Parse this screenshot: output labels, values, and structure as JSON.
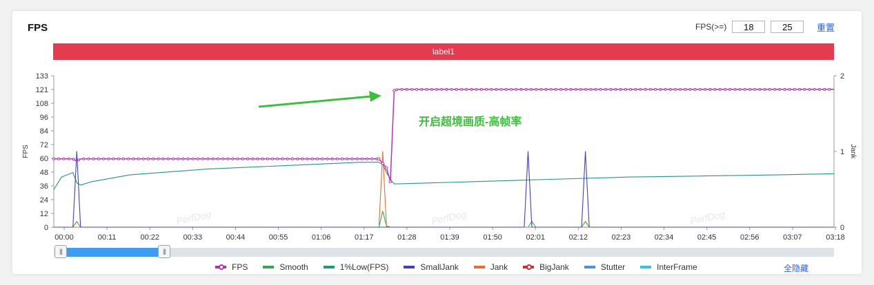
{
  "panel": {
    "title": "FPS"
  },
  "fps_threshold": {
    "label": "FPS(>=)",
    "low": "18",
    "high": "25",
    "reset_label": "重置"
  },
  "label_bar": {
    "text": "label1"
  },
  "annotation": {
    "text": "开启超境画质-高帧率"
  },
  "watermark": "PerfDog",
  "legend": {
    "items": [
      {
        "name": "FPS",
        "color": "#b832b0",
        "marker": true
      },
      {
        "name": "Smooth",
        "color": "#33a852",
        "marker": false
      },
      {
        "name": "1%Low(FPS)",
        "color": "#1f9688",
        "marker": false
      },
      {
        "name": "SmallJank",
        "color": "#3f3fc8",
        "marker": false
      },
      {
        "name": "Jank",
        "color": "#ef6a2e",
        "marker": false
      },
      {
        "name": "BigJank",
        "color": "#d82b2b",
        "marker": true
      },
      {
        "name": "Stutter",
        "color": "#4a8fe8",
        "marker": false
      },
      {
        "name": "InterFrame",
        "color": "#2ec8dc",
        "marker": false
      }
    ],
    "hide_all_label": "全隐藏"
  },
  "chart_data": {
    "type": "line",
    "ylabel": "FPS",
    "y2label": "Jank",
    "ylim": [
      0,
      133
    ],
    "y2lim": [
      0,
      2
    ],
    "xlim": [
      0,
      204
    ],
    "yticks": [
      "0",
      "12",
      "24",
      "36",
      "48",
      "60",
      "72",
      "84",
      "96",
      "108",
      "121",
      "133"
    ],
    "y2ticks": [
      "0",
      "1",
      "2"
    ],
    "xticks": [
      "00:00",
      "00:11",
      "00:22",
      "00:33",
      "00:44",
      "00:55",
      "01:06",
      "01:17",
      "01:28",
      "01:39",
      "01:50",
      "02:01",
      "02:12",
      "02:23",
      "02:34",
      "02:45",
      "02:56",
      "03:07",
      "03:18"
    ],
    "series": [
      {
        "name": "FPS",
        "axis": "left",
        "points": [
          [
            0,
            60
          ],
          [
            5,
            60
          ],
          [
            6,
            58
          ],
          [
            7,
            60
          ],
          [
            85,
            60
          ],
          [
            86,
            56
          ],
          [
            87,
            52
          ],
          [
            88,
            40
          ],
          [
            89,
            120
          ],
          [
            90,
            121
          ],
          [
            204,
            121
          ]
        ]
      },
      {
        "name": "1%Low(FPS)",
        "axis": "left",
        "points": [
          [
            0,
            33
          ],
          [
            2,
            44
          ],
          [
            5,
            48
          ],
          [
            6,
            39
          ],
          [
            7,
            37
          ],
          [
            10,
            40
          ],
          [
            20,
            46
          ],
          [
            40,
            51
          ],
          [
            60,
            54
          ],
          [
            80,
            57
          ],
          [
            85,
            57
          ],
          [
            86,
            55
          ],
          [
            87,
            48
          ],
          [
            88,
            42
          ],
          [
            89,
            38
          ],
          [
            90,
            38
          ],
          [
            110,
            40
          ],
          [
            130,
            42
          ],
          [
            150,
            44
          ],
          [
            170,
            45
          ],
          [
            190,
            46
          ],
          [
            204,
            47
          ]
        ]
      },
      {
        "name": "SmallJank",
        "axis": "right",
        "points": [
          [
            0,
            0
          ],
          [
            5,
            0
          ],
          [
            6,
            1
          ],
          [
            7,
            0
          ],
          [
            123,
            0
          ],
          [
            124,
            1
          ],
          [
            125,
            0
          ],
          [
            138,
            0
          ],
          [
            139,
            1
          ],
          [
            140,
            0
          ],
          [
            204,
            0
          ]
        ]
      },
      {
        "name": "Jank",
        "axis": "right",
        "points": [
          [
            0,
            0
          ],
          [
            85,
            0
          ],
          [
            86,
            1
          ],
          [
            87,
            0
          ],
          [
            204,
            0
          ]
        ]
      },
      {
        "name": "Smooth",
        "axis": "left",
        "points": [
          [
            0,
            0
          ],
          [
            5,
            0
          ],
          [
            6,
            5
          ],
          [
            7,
            0
          ],
          [
            85,
            0
          ],
          [
            86,
            14
          ],
          [
            87,
            1
          ],
          [
            88,
            0
          ],
          [
            124,
            0
          ],
          [
            125,
            5
          ],
          [
            126,
            0
          ],
          [
            138,
            0
          ],
          [
            139,
            5
          ],
          [
            140,
            0
          ],
          [
            204,
            0
          ]
        ]
      }
    ]
  }
}
